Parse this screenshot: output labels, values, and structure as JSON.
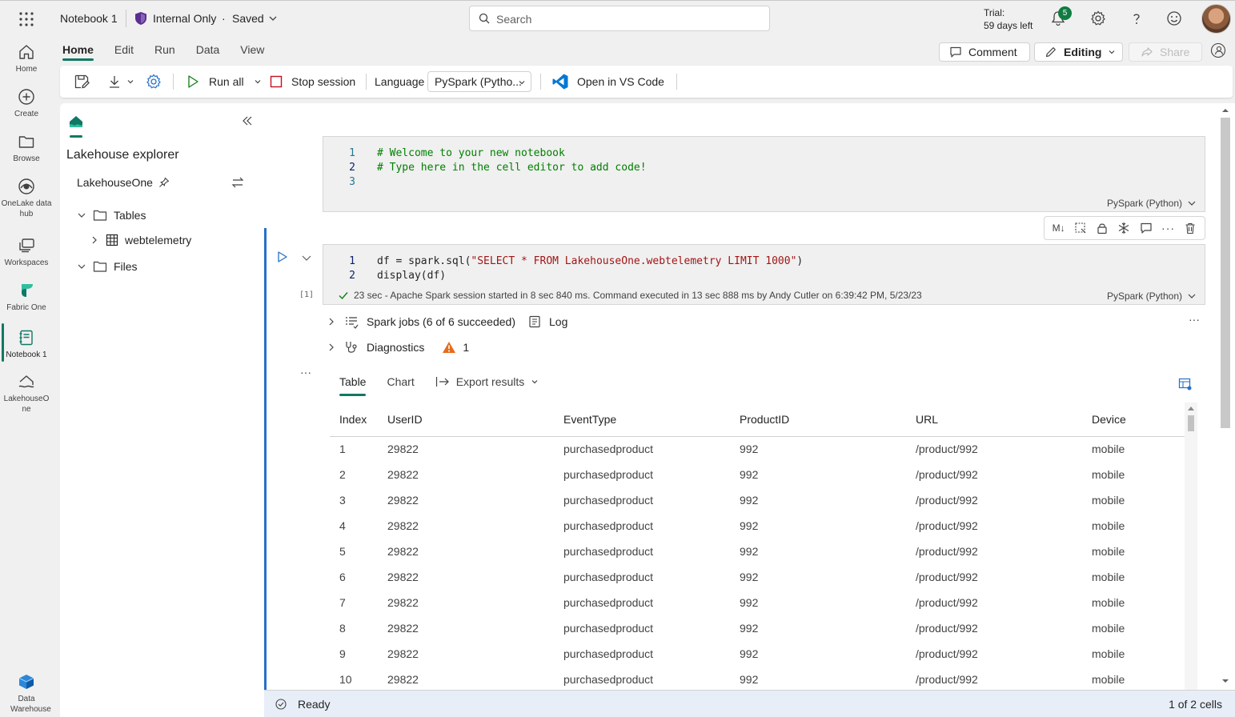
{
  "header": {
    "notebook_title": "Notebook 1",
    "sensitivity": "Internal Only",
    "separator": "·",
    "save_state": "Saved",
    "search_placeholder": "Search",
    "trial_label": "Trial:",
    "trial_days": "59 days left",
    "notifications_count": "5"
  },
  "rail": [
    {
      "label": "Home",
      "icon": "home-icon"
    },
    {
      "label": "Create",
      "icon": "create-icon"
    },
    {
      "label": "Browse",
      "icon": "folder-icon"
    },
    {
      "label": "OneLake data hub",
      "icon": "onelake-icon"
    },
    {
      "label": "Workspaces",
      "icon": "workspaces-icon"
    },
    {
      "label": "Fabric One",
      "icon": "fabric-icon"
    },
    {
      "label": "Notebook 1",
      "icon": "notebook-icon"
    },
    {
      "label": "LakehouseOne",
      "icon": "lakehouse-icon"
    },
    {
      "label": "Data Warehouse",
      "icon": "datawarehouse-icon"
    }
  ],
  "ribbon": {
    "tabs": [
      "Home",
      "Edit",
      "Run",
      "Data",
      "View"
    ],
    "active_tab": "Home",
    "comment": "Comment",
    "editing": "Editing",
    "share": "Share"
  },
  "toolbar": {
    "run_all": "Run all",
    "stop_session": "Stop session",
    "language_label": "Language",
    "language_value": "PySpark (Pytho...",
    "open_vscode": "Open in VS Code"
  },
  "explorer": {
    "title": "Lakehouse explorer",
    "lakehouse_name": "LakehouseOne",
    "tree": {
      "tables": "Tables",
      "table_item": "webtelemetry",
      "files": "Files"
    }
  },
  "cell1": {
    "lines": [
      {
        "n": "1",
        "text": "# Welcome to your new notebook"
      },
      {
        "n": "2",
        "text": "# Type here in the cell editor to add code!"
      },
      {
        "n": "3",
        "text": ""
      }
    ],
    "language": "PySpark (Python)"
  },
  "cell2": {
    "line1_n": "1",
    "line1_pre": "df = spark.sql(",
    "line1_str": "\"SELECT * FROM LakehouseOne.webtelemetry LIMIT 1000\"",
    "line1_post": ")",
    "line2_n": "2",
    "line2": "display(df)",
    "exec_count": "[1]",
    "status": "23 sec - Apache Spark session started in 8 sec 840 ms. Command executed in 13 sec 888 ms by Andy Cutler on 6:39:42 PM, 5/23/23",
    "language": "PySpark (Python)"
  },
  "output": {
    "spark_jobs": "Spark jobs (6 of 6 succeeded)",
    "log": "Log",
    "diagnostics": "Diagnostics",
    "diagnostics_warnings": "1",
    "tabs": [
      "Table",
      "Chart",
      "Export results"
    ],
    "columns": [
      "Index",
      "UserID",
      "EventType",
      "ProductID",
      "URL",
      "Device"
    ],
    "rows": [
      [
        "1",
        "29822",
        "purchasedproduct",
        "992",
        "/product/992",
        "mobile"
      ],
      [
        "2",
        "29822",
        "purchasedproduct",
        "992",
        "/product/992",
        "mobile"
      ],
      [
        "3",
        "29822",
        "purchasedproduct",
        "992",
        "/product/992",
        "mobile"
      ],
      [
        "4",
        "29822",
        "purchasedproduct",
        "992",
        "/product/992",
        "mobile"
      ],
      [
        "5",
        "29822",
        "purchasedproduct",
        "992",
        "/product/992",
        "mobile"
      ],
      [
        "6",
        "29822",
        "purchasedproduct",
        "992",
        "/product/992",
        "mobile"
      ],
      [
        "7",
        "29822",
        "purchasedproduct",
        "992",
        "/product/992",
        "mobile"
      ],
      [
        "8",
        "29822",
        "purchasedproduct",
        "992",
        "/product/992",
        "mobile"
      ],
      [
        "9",
        "29822",
        "purchasedproduct",
        "992",
        "/product/992",
        "mobile"
      ],
      [
        "10",
        "29822",
        "purchasedproduct",
        "992",
        "/product/992",
        "mobile"
      ]
    ]
  },
  "statusbar": {
    "state": "Ready",
    "cells": "1 of 2 cells"
  },
  "colors": {
    "accent": "#117865",
    "active_cell": "#2670c7",
    "stop": "#c50f1f",
    "warning": "#e66c1a",
    "success": "#107c10"
  }
}
